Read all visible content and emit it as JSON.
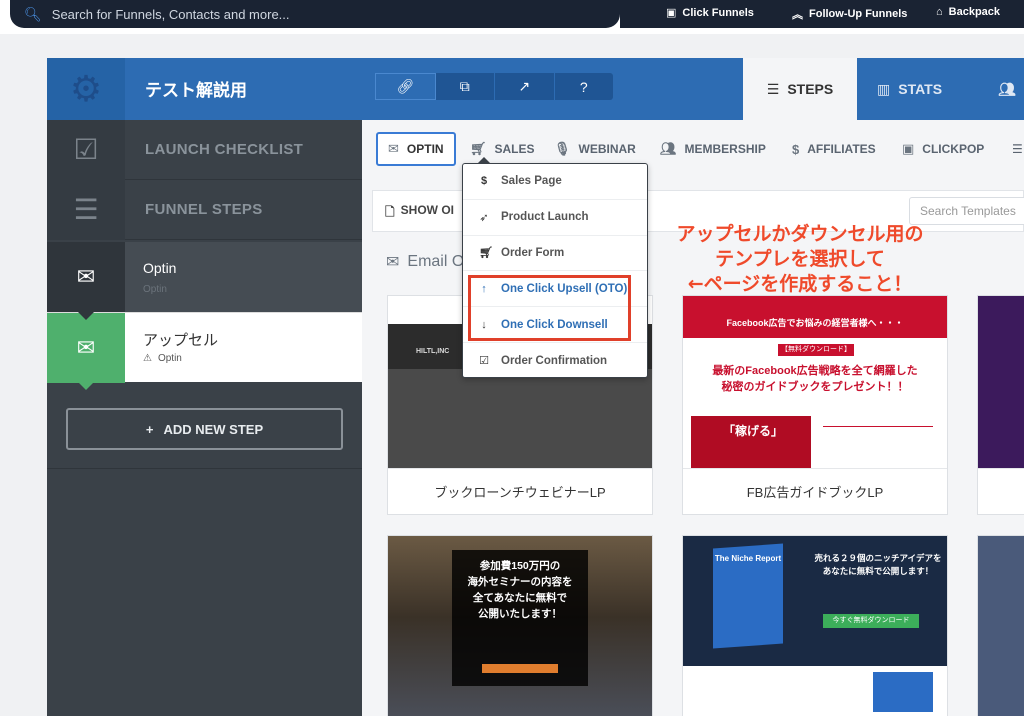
{
  "topbar": {
    "search_placeholder": "Search for Funnels, Contacts and more...",
    "links": [
      "Click Funnels",
      "Follow-Up Funnels",
      "Backpack"
    ]
  },
  "header": {
    "funnel_title": "テスト解説用",
    "tabs": {
      "steps": "STEPS",
      "stats": "STATS"
    }
  },
  "sidebar": {
    "launch_checklist": "LAUNCH CHECKLIST",
    "funnel_steps": "FUNNEL STEPS",
    "steps": [
      {
        "name": "Optin",
        "type": "Optin"
      },
      {
        "name": "アップセル",
        "type": "Optin"
      }
    ],
    "add_step": "ADD NEW STEP"
  },
  "categories": [
    "OPTIN",
    "SALES",
    "WEBINAR",
    "MEMBERSHIP",
    "AFFILIATES",
    "CLICKPOP"
  ],
  "filter": {
    "show_all": "SHOW OI",
    "search_placeholder": "Search Templates"
  },
  "section_title": "Email O",
  "dropdown": {
    "items": [
      "Sales Page",
      "Product Launch",
      "Order Form",
      "One Click Upsell (OTO)",
      "One Click Downsell",
      "Order Confirmation"
    ]
  },
  "annotation": {
    "line1": "アップセルかダウンセル用の",
    "line2": "テンプレを選択して",
    "line3": "←ページを作成すること！"
  },
  "cards": [
    {
      "caption": "ブックローンチウェビナーLP",
      "thumb_text": "HILTL,INC"
    },
    {
      "caption": "FB広告ガイドブックLP",
      "thumb_lines": [
        "Facebook広告でお悩みの経営者様へ・・・",
        "【無料ダウンロード】",
        "最新のFacebook広告戦略を全て網羅した",
        "秘密のガイドブックをプレゼント！！",
        "「稼げる」"
      ]
    },
    {
      "caption": "",
      "thumb_lines": [
        "参加費150万円の",
        "海外セミナーの内容を",
        "全てあなたに無料で",
        "公開いたします！"
      ]
    },
    {
      "caption": "",
      "thumb_lines": [
        "The Niche Report",
        "売れる２９個のニッチアイデアを",
        "あなたに無料で公開します！",
        "今すぐ無料ダウンロード"
      ]
    }
  ],
  "colors": {
    "header_blue": "#2d6cb3",
    "sidebar": "#3a4148",
    "step_green": "#4fb06d",
    "annotation_red": "#ef4a2b"
  }
}
